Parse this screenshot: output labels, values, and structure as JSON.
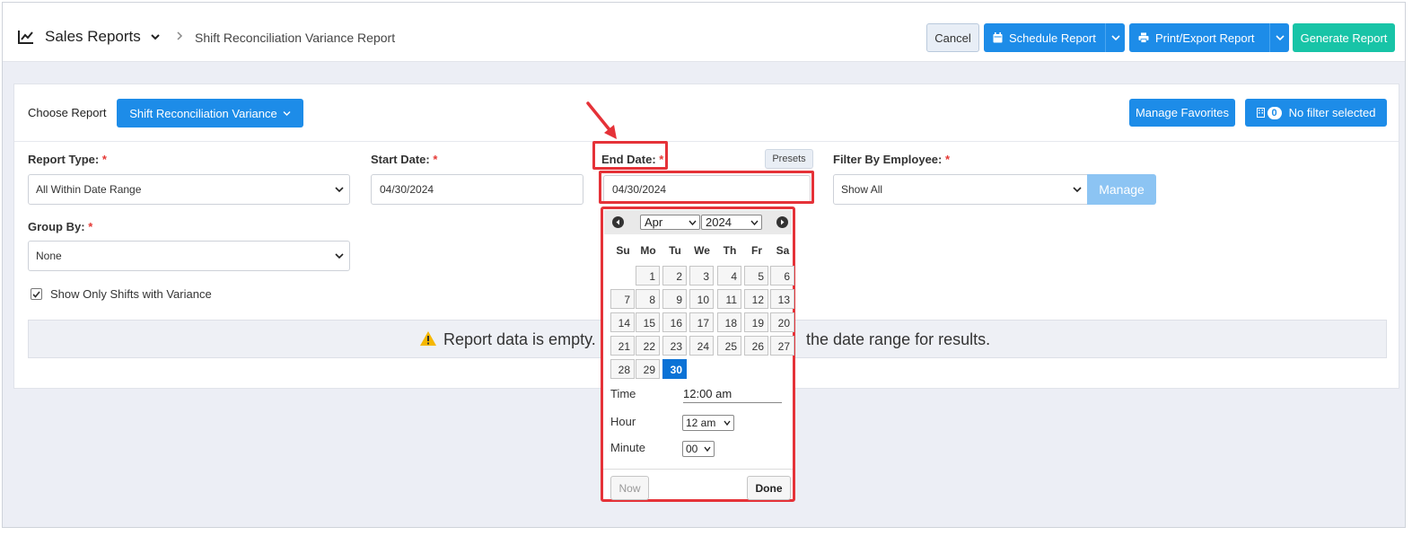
{
  "header": {
    "title": "Sales Reports",
    "breadcrumb": "Shift Reconciliation Variance Report",
    "cancel": "Cancel",
    "schedule": "Schedule Report",
    "print_export": "Print/Export Report",
    "generate": "Generate Report"
  },
  "toolbar": {
    "choose_label": "Choose Report",
    "choose_value": "Shift Reconciliation Variance",
    "manage_favorites": "Manage Favorites",
    "filter_count": "0",
    "filter_text": "No filter selected"
  },
  "form": {
    "report_type_label": "Report Type:",
    "report_type_value": "All Within Date Range",
    "start_date_label": "Start Date:",
    "start_date_value": "04/30/2024",
    "end_date_label": "End Date:",
    "end_date_value": "04/30/2024",
    "presets": "Presets",
    "filter_employee_label": "Filter By Employee:",
    "filter_employee_value": "Show All",
    "manage": "Manage",
    "group_by_label": "Group By:",
    "group_by_value": "None",
    "show_variance": "Show Only Shifts with Variance",
    "required": "*"
  },
  "banner": {
    "text_left": "Report data is empty.",
    "text_right": "the date range for results."
  },
  "picker": {
    "month": "Apr",
    "year": "2024",
    "weekdays": [
      "Su",
      "Mo",
      "Tu",
      "We",
      "Th",
      "Fr",
      "Sa"
    ],
    "days": [
      "1",
      "2",
      "3",
      "4",
      "5",
      "6",
      "7",
      "8",
      "9",
      "10",
      "11",
      "12",
      "13",
      "14",
      "15",
      "16",
      "17",
      "18",
      "19",
      "20",
      "21",
      "22",
      "23",
      "24",
      "25",
      "26",
      "27",
      "28",
      "29",
      "30"
    ],
    "selected_day": "30",
    "time_label": "Time",
    "time_value": "12:00 am",
    "hour_label": "Hour",
    "hour_value": "12 am",
    "minute_label": "Minute",
    "minute_value": "00",
    "now": "Now",
    "done": "Done"
  },
  "colors": {
    "primary": "#1d8ce8",
    "generate": "#18c4a7",
    "highlight": "#e53238",
    "selected_day": "#0b72d6"
  }
}
